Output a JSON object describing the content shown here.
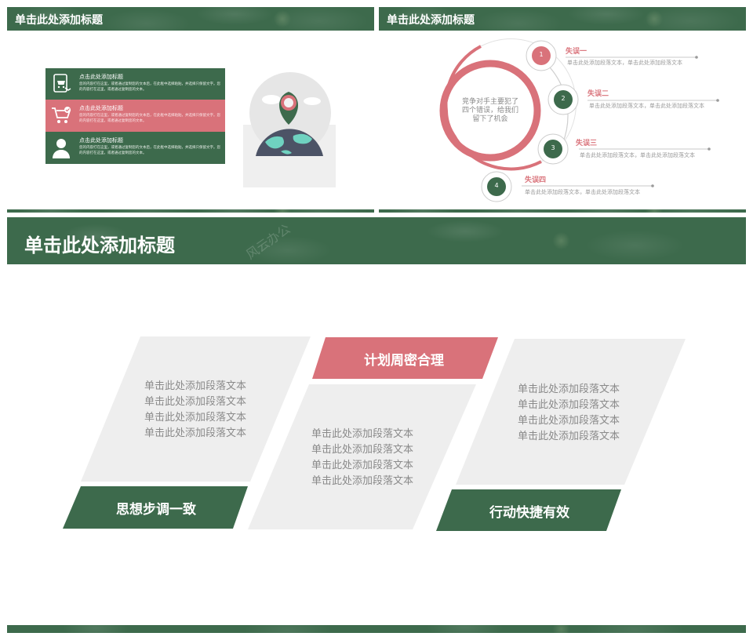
{
  "colors": {
    "green": "#3d6a4c",
    "pink": "#d9727a",
    "gray_block": "#eeeeee",
    "text_gray": "#8a8a8a"
  },
  "watermark": "风云办公",
  "slide1": {
    "title": "单击此处添加标题",
    "rows": [
      {
        "icon": "tablet-cart-icon",
        "heading": "点击此处添加标题",
        "body": "您的内容打在这里，或者通过复制您的文本后，在此框中选择粘贴，并选择只保留文字。您的内容打在这里，或者通过复制您的文本。"
      },
      {
        "icon": "shopping-cart-icon",
        "heading": "点击此处添加标题",
        "body": "您的内容打在这里，或者通过复制您的文本后，在此框中选择粘贴，并选择只保留文字。您的内容打在这里，或者通过复制您的文本。"
      },
      {
        "icon": "person-icon",
        "heading": "点击此处添加标题",
        "body": "您的内容打在这里，或者通过复制您的文本后，在此框中选择粘贴，并选择只保留文字。您的内容打在这里，或者通过复制您的文本。"
      }
    ]
  },
  "slide2": {
    "title": "单击此处添加标题",
    "center_text": [
      "竞争对手主要犯了",
      "四个错误，给我们",
      "留下了机会"
    ],
    "items": [
      {
        "num": "1",
        "title": "失误一",
        "desc": "单击此处添加段落文本，单击此处添加段落文本"
      },
      {
        "num": "2",
        "title": "失误二",
        "desc": "单击此处添加段落文本，单击此处添加段落文本"
      },
      {
        "num": "3",
        "title": "失误三",
        "desc": "单击此处添加段落文本，单击此处添加段落文本"
      },
      {
        "num": "4",
        "title": "失误四",
        "desc": "单击此处添加段落文本，单击此处添加段落文本"
      }
    ]
  },
  "slide3": {
    "title": "单击此处添加标题",
    "panels": [
      {
        "label": "思想步调一致",
        "lines": [
          "单击此处添加段落文本",
          "单击此处添加段落文本",
          "单击此处添加段落文本",
          "单击此处添加段落文本"
        ]
      },
      {
        "label": "计划周密合理",
        "lines": [
          "单击此处添加段落文本",
          "单击此处添加段落文本",
          "单击此处添加段落文本",
          "单击此处添加段落文本"
        ]
      },
      {
        "label": "行动快捷有效",
        "lines": [
          "单击此处添加段落文本",
          "单击此处添加段落文本",
          "单击此处添加段落文本",
          "单击此处添加段落文本"
        ]
      }
    ]
  }
}
